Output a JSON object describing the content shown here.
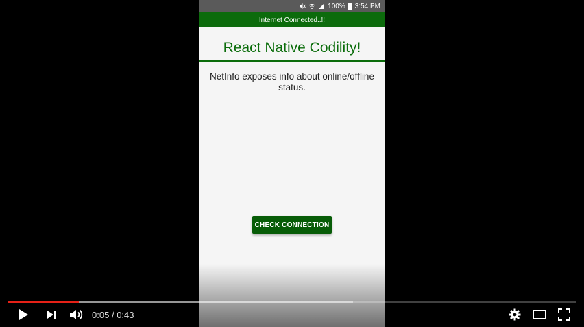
{
  "status_bar": {
    "battery": "100%",
    "time": "3:54 PM"
  },
  "app": {
    "network_banner": "Internet Connected..!!",
    "title": "React Native Codility!",
    "description": "NetInfo exposes info about online/offline status.",
    "check_button_label": "CHECK CONNECTION",
    "colors": {
      "banner_bg": "#0c6b0c",
      "title_color": "#0b6d0b",
      "button_bg": "#075c07"
    }
  },
  "player": {
    "current_time": "0:05",
    "separator": "/",
    "duration": "0:43",
    "played_fraction": 0.125,
    "buffered_fraction": 0.607,
    "progress_color": "#e62117",
    "icons": [
      "play-icon",
      "next-icon",
      "volume-icon",
      "settings-icon",
      "theater-mode-icon",
      "fullscreen-icon"
    ]
  }
}
